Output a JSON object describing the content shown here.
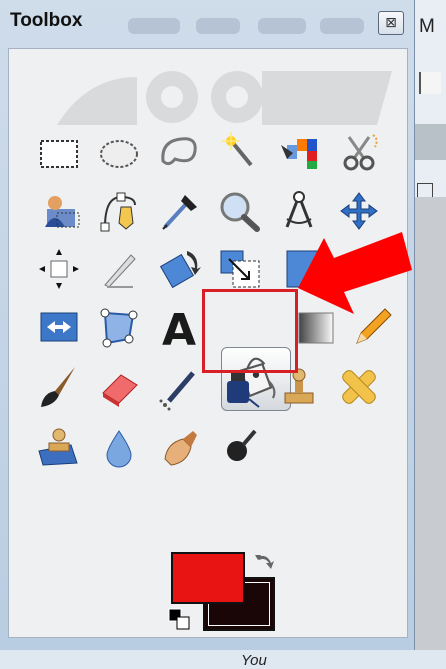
{
  "window": {
    "title": "Toolbox",
    "close_glyph": "⊠"
  },
  "background_window": {
    "title_fragment": "M"
  },
  "tools": [
    {
      "name": "rect-select-tool-icon"
    },
    {
      "name": "ellipse-select-tool-icon"
    },
    {
      "name": "free-select-tool-icon"
    },
    {
      "name": "fuzzy-select-tool-icon"
    },
    {
      "name": "color-select-tool-icon"
    },
    {
      "name": "scissors-select-tool-icon"
    },
    {
      "name": "foreground-select-tool-icon"
    },
    {
      "name": "paths-tool-icon"
    },
    {
      "name": "color-picker-tool-icon"
    },
    {
      "name": "zoom-tool-icon"
    },
    {
      "name": "measure-tool-icon"
    },
    {
      "name": "move-tool-icon"
    },
    {
      "name": "align-tool-icon"
    },
    {
      "name": "crop-tool-icon"
    },
    {
      "name": "rotate-tool-icon"
    },
    {
      "name": "scale-tool-icon"
    },
    {
      "name": "shear-tool-icon"
    },
    {
      "name": "perspective-tool-icon"
    },
    {
      "name": "flip-tool-icon"
    },
    {
      "name": "cage-transform-tool-icon"
    },
    {
      "name": "text-tool-icon",
      "glyph": "A"
    },
    {
      "name": "bucket-fill-tool-icon",
      "selected": true
    },
    {
      "name": "blend-tool-icon"
    },
    {
      "name": "pencil-tool-icon"
    },
    {
      "name": "paintbrush-tool-icon"
    },
    {
      "name": "eraser-tool-icon"
    },
    {
      "name": "airbrush-tool-icon"
    },
    {
      "name": "ink-tool-icon"
    },
    {
      "name": "clone-tool-icon"
    },
    {
      "name": "heal-tool-icon"
    },
    {
      "name": "perspective-clone-tool-icon"
    },
    {
      "name": "blur-sharpen-tool-icon"
    },
    {
      "name": "smudge-tool-icon"
    },
    {
      "name": "dodge-burn-tool-icon"
    }
  ],
  "colors": {
    "foreground": "#e81414",
    "background": "#1a0606",
    "swap_icon": "swap-arrows-icon",
    "default_icon": "default-colors-icon"
  },
  "annotation": {
    "highlight_color": "#d81f26",
    "arrow_color": "#ff0000"
  },
  "active_image_label": "You"
}
